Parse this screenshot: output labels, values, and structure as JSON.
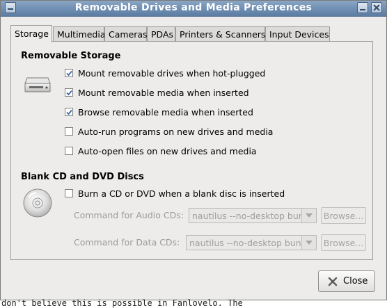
{
  "window": {
    "title": "Removable Drives and Media Preferences"
  },
  "tabs": [
    {
      "label": "Storage",
      "active": true
    },
    {
      "label": "Multimedia"
    },
    {
      "label": "Cameras"
    },
    {
      "label": "PDAs"
    },
    {
      "label": "Printers & Scanners"
    },
    {
      "label": "Input Devices"
    }
  ],
  "removable_storage": {
    "heading": "Removable Storage",
    "icon": "drive-icon",
    "options": [
      {
        "label": "Mount removable drives when hot-plugged",
        "checked": true
      },
      {
        "label": "Mount removable media when inserted",
        "checked": true
      },
      {
        "label": "Browse removable media when inserted",
        "checked": true
      },
      {
        "label": "Auto-run programs on new drives and media",
        "checked": false
      },
      {
        "label": "Auto-open files on new drives and media",
        "checked": false
      }
    ]
  },
  "blank_discs": {
    "heading": "Blank CD and DVD Discs",
    "icon": "cd-icon",
    "burn_option": {
      "label": "Burn a CD or DVD when a blank disc is inserted",
      "checked": false
    },
    "audio_cmd": {
      "label": "Command for Audio CDs:",
      "value": "nautilus --no-desktop bun",
      "browse": "Browse..."
    },
    "data_cmd": {
      "label": "Command for Data CDs:",
      "value": "nautilus --no-desktop bun",
      "browse": "Browse..."
    }
  },
  "footer": {
    "close_label": "Close"
  },
  "background_text": "don't believe this is possible in Fanlovelo. The"
}
